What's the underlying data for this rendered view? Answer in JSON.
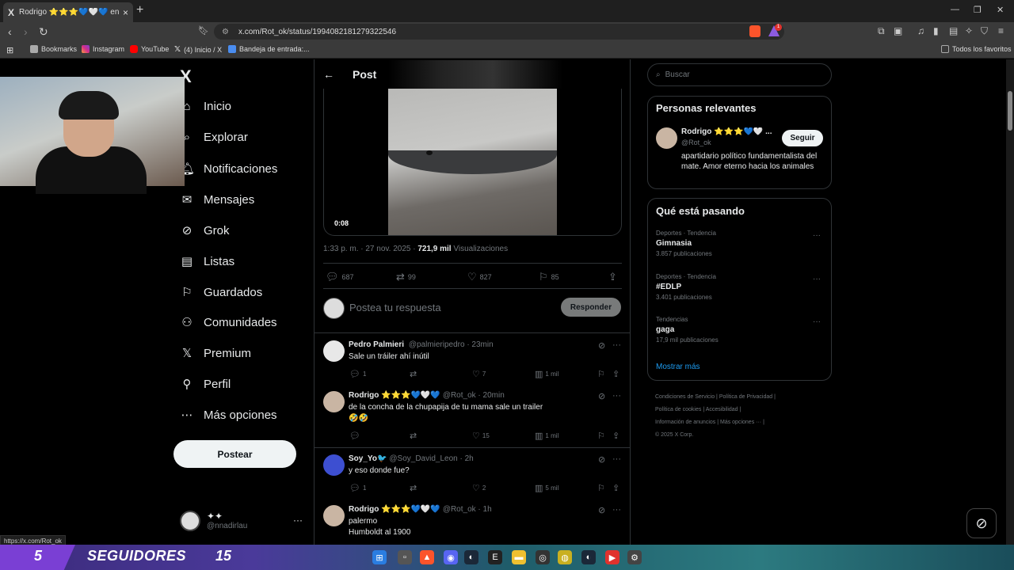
{
  "browser": {
    "tab_title": "Rodrigo ⭐⭐⭐💙🤍💙 en X",
    "tab_favicon": "X",
    "url": "x.com/Rot_ok/status/1994082181279322546",
    "bookmarks": [
      {
        "label": "Bookmarks",
        "icon": "folder-icon"
      },
      {
        "label": "Instagram",
        "icon": "instagram-icon"
      },
      {
        "label": "YouTube",
        "icon": "youtube-icon"
      },
      {
        "label": "(4) Inicio / X",
        "icon": "x-icon"
      },
      {
        "label": "Bandeja de entrada:...",
        "icon": "mail-icon"
      }
    ],
    "all_favorites": "Todos los favoritos",
    "brave_badge": "1",
    "status_url": "https://x.com/Rot_ok"
  },
  "sidebar": {
    "logo": "X",
    "items": [
      {
        "label": "Inicio",
        "icon": "home-icon"
      },
      {
        "label": "Explorar",
        "icon": "search-icon"
      },
      {
        "label": "Notificaciones",
        "icon": "bell-icon"
      },
      {
        "label": "Mensajes",
        "icon": "mail-icon"
      },
      {
        "label": "Grok",
        "icon": "grok-icon"
      },
      {
        "label": "Listas",
        "icon": "list-icon"
      },
      {
        "label": "Guardados",
        "icon": "bookmark-icon"
      },
      {
        "label": "Comunidades",
        "icon": "people-icon"
      },
      {
        "label": "Premium",
        "icon": "x-icon"
      },
      {
        "label": "Perfil",
        "icon": "user-icon"
      },
      {
        "label": "Más opciones",
        "icon": "more-circle-icon"
      }
    ],
    "post_button": "Postear",
    "account": {
      "name": "✦✦",
      "handle": "@nnadirlau"
    }
  },
  "post": {
    "header_title": "Post",
    "video_time": "0:08",
    "time": "1:33 p. m. · 27 nov. 2025 · ",
    "views": "721,9 mil",
    "views_label": " Visualizaciones",
    "stats": {
      "replies": "687",
      "reposts": "99",
      "likes": "827",
      "bookmarks": "85"
    },
    "reply_placeholder": "Postea tu respuesta",
    "reply_button": "Responder"
  },
  "replies": [
    {
      "name": "Pedro Palmieri ",
      "handle": "@palmieripedro · 23min",
      "text": "Sale un tráiler ahí inútil",
      "text2": "",
      "replies": "1",
      "reposts": "",
      "likes": "7",
      "views": "1 mil"
    },
    {
      "name": "Rodrigo ⭐⭐⭐💙🤍💙",
      "handle": "@Rot_ok · 20min",
      "text": "de la concha de la chupapija de tu mama sale un trailer",
      "text2": "🤣🤣",
      "replies": "",
      "reposts": "",
      "likes": "15",
      "views": "1 mil"
    },
    {
      "name": "Soy_Yo🐦",
      "handle": "@Soy_David_Leon · 2h",
      "text": "y eso donde fue?",
      "text2": "",
      "replies": "1",
      "reposts": "",
      "likes": "2",
      "views": "5 mil"
    },
    {
      "name": "Rodrigo ⭐⭐⭐💙🤍💙",
      "handle": "@Rot_ok · 1h",
      "text": "palermo",
      "text2": "Humboldt al 1900",
      "replies": "",
      "reposts": "",
      "likes": "",
      "views": ""
    }
  ],
  "right": {
    "search_placeholder": "Buscar",
    "relevant_title": "Personas relevantes",
    "relevant": {
      "name": "Rodrigo ⭐⭐⭐💙🤍 ...",
      "handle": "@Rot_ok",
      "bio": "apartidario político fundamentalista del mate. Amor eterno hacia los animales",
      "follow": "Seguir"
    },
    "trending_title": "Qué está pasando",
    "trends": [
      {
        "category": "Deportes · Tendencia",
        "name": "Gimnasia",
        "count": "3.857 publicaciones"
      },
      {
        "category": "Deportes · Tendencia",
        "name": "#EDLP",
        "count": "3.401 publicaciones"
      },
      {
        "category": "Tendencias",
        "name": "gaga",
        "count": "17,9 mil publicaciones"
      }
    ],
    "show_more": "Mostrar más",
    "footer": [
      "Condiciones de Servicio",
      "Política de Privacidad",
      "Política de cookies",
      "Accesibilidad",
      "Información de anuncios",
      "Más opciones ···",
      "© 2025 X Corp."
    ]
  },
  "overlay": {
    "followers_now": "5",
    "label": "SEGUIDORES",
    "followers_goal": "15"
  },
  "colors": {
    "accent": "#1d9bf0",
    "background": "#000000",
    "muted": "#71767b",
    "border": "#2f3336"
  }
}
